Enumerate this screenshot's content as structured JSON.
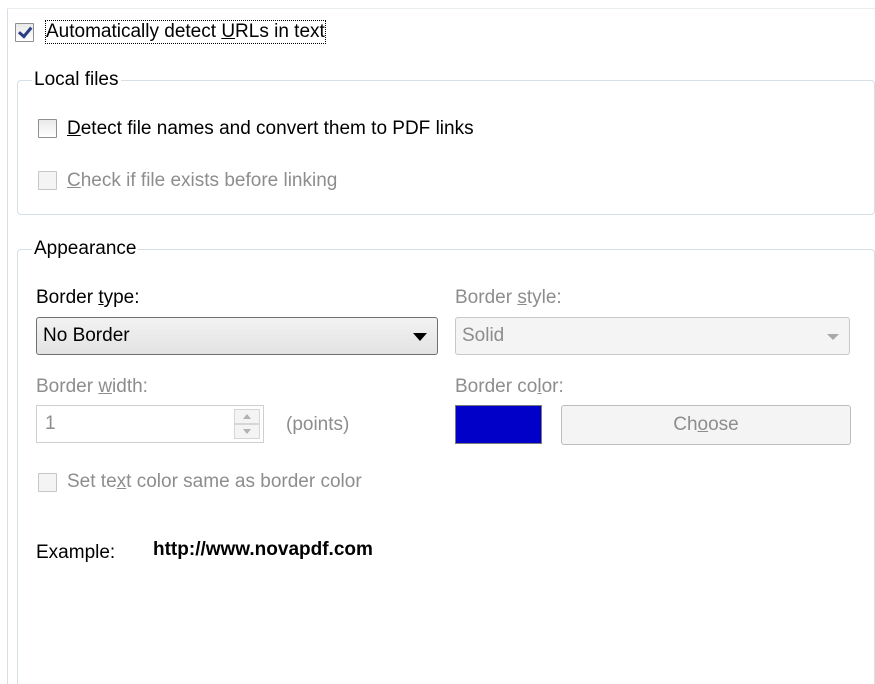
{
  "auto_detect": {
    "checked": true,
    "label_parts": [
      "Automatically detect ",
      "U",
      "RLs in text"
    ]
  },
  "local_files": {
    "title": "Local files",
    "detect_file_names": {
      "checked": false,
      "label_parts": [
        "",
        "D",
        "etect file names and convert them to PDF links"
      ]
    },
    "check_exists": {
      "checked": false,
      "disabled": true,
      "label_parts": [
        "",
        "C",
        "heck if file exists before linking"
      ]
    }
  },
  "appearance": {
    "title": "Appearance",
    "border_type": {
      "label_parts": [
        "Border ",
        "t",
        "ype:"
      ],
      "value": "No Border"
    },
    "border_style": {
      "label_parts": [
        "Border ",
        "s",
        "tyle:"
      ],
      "value": "Solid"
    },
    "border_width": {
      "label_parts": [
        "Border ",
        "w",
        "idth:"
      ],
      "value": "1",
      "unit": "(points)"
    },
    "border_color": {
      "label_parts": [
        "Border co",
        "l",
        "or:"
      ],
      "swatch_color": "#0000c8",
      "choose_parts": [
        "Ch",
        "o",
        "ose"
      ]
    },
    "text_color_same": {
      "checked": false,
      "disabled": true,
      "label_parts": [
        "Set te",
        "x",
        "t color same as border color"
      ]
    },
    "example": {
      "label": "Example:",
      "url": "http://www.novapdf.com"
    }
  },
  "icons": {
    "checkmark": "checkmark-icon",
    "dropdown": "chevron-down-icon",
    "spin_up": "spin-up-icon",
    "spin_down": "spin-down-icon"
  }
}
